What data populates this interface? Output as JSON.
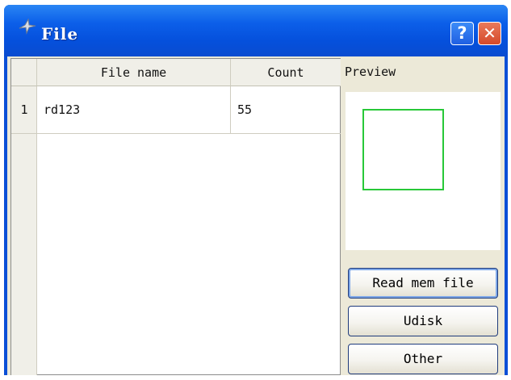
{
  "window": {
    "title": "File",
    "icons": [
      "app-icon",
      "help-icon",
      "close-icon"
    ]
  },
  "title_buttons": {
    "help_label": "?",
    "close_label": "✕"
  },
  "table": {
    "columns": [
      "File name",
      "Count"
    ],
    "rows": [
      {
        "index": "1",
        "file_name": "rd123",
        "count": "55"
      }
    ]
  },
  "preview": {
    "label": "Preview",
    "frame_color": "#28c838"
  },
  "buttons": {
    "read_mem_file": "Read mem file",
    "udisk": "Udisk",
    "other": "Other"
  },
  "colors": {
    "titlebar": "#0550dc",
    "client": "#ece9d8",
    "close": "#d5492a"
  }
}
